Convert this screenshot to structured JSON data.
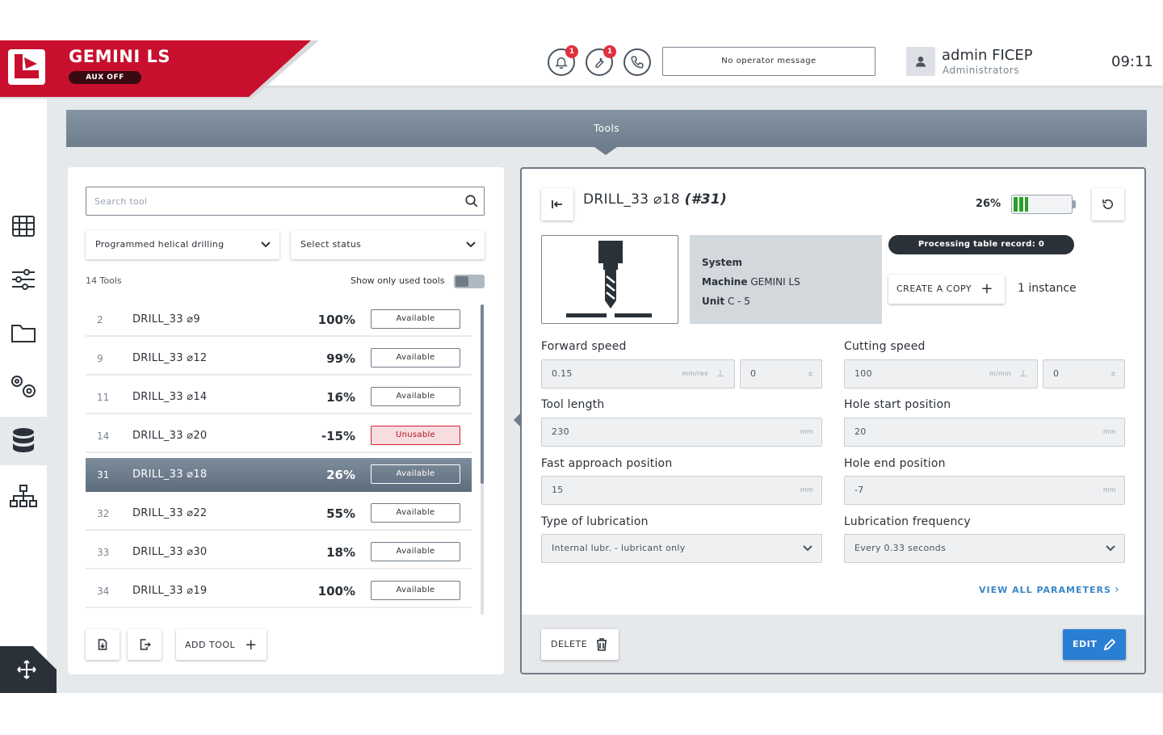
{
  "header": {
    "brand_title": "GEMINI LS",
    "aux_status": "AUX OFF",
    "notifications_badge": "1",
    "maintenance_badge": "1",
    "operator_message": "No operator message",
    "user_name": "admin FICEP",
    "user_role": "Administrators",
    "clock": "09:11",
    "brand_color": "#c8102e"
  },
  "sidebar": {
    "items": [
      {
        "name": "grid-icon"
      },
      {
        "name": "sliders-icon"
      },
      {
        "name": "folder-icon"
      },
      {
        "name": "gears-icon"
      },
      {
        "name": "database-icon",
        "active": true
      },
      {
        "name": "network-icon"
      }
    ]
  },
  "page": {
    "title": "Tools"
  },
  "tools_panel": {
    "search_placeholder": "Search tool",
    "filter_program": "Programmed helical drilling",
    "filter_status": "Select status",
    "tools_count": "14 Tools",
    "show_used_label": "Show only used tools",
    "show_used_enabled": false,
    "tools": [
      {
        "num": "2",
        "name": "DRILL_33 ⌀9",
        "pct": "100%",
        "status": "Available"
      },
      {
        "num": "9",
        "name": "DRILL_33 ⌀12",
        "pct": "99%",
        "status": "Available"
      },
      {
        "num": "11",
        "name": "DRILL_33 ⌀14",
        "pct": "16%",
        "status": "Available"
      },
      {
        "num": "14",
        "name": "DRILL_33 ⌀20",
        "pct": "-15%",
        "status": "Unusable"
      },
      {
        "num": "31",
        "name": "DRILL_33 ⌀18",
        "pct": "26%",
        "status": "Available",
        "selected": true
      },
      {
        "num": "32",
        "name": "DRILL_33 ⌀22",
        "pct": "55%",
        "status": "Available"
      },
      {
        "num": "33",
        "name": "DRILL_33 ⌀30",
        "pct": "18%",
        "status": "Available"
      },
      {
        "num": "34",
        "name": "DRILL_33 ⌀19",
        "pct": "100%",
        "status": "Available"
      }
    ],
    "add_tool_label": "ADD TOOL"
  },
  "detail": {
    "tool_name": "DRILL_33 ⌀18",
    "tool_id": "(#31)",
    "wear_pct": "26%",
    "wear_fraction": 0.26,
    "system_label": "System",
    "machine_label": "Machine",
    "machine_value": "GEMINI LS",
    "unit_label": "Unit",
    "unit_value": "C - 5",
    "processing_record": "Processing table record: 0",
    "create_copy_label": "CREATE A COPY",
    "instance_text": "1 instance",
    "forward_speed_label": "Forward speed",
    "forward_speed_value": "0.15",
    "forward_speed_unit": "mm/rev",
    "forward_speed_offset": "0",
    "cutting_speed_label": "Cutting speed",
    "cutting_speed_value": "100",
    "cutting_speed_unit": "m/min",
    "cutting_speed_offset": "0",
    "offset_unit": "±",
    "tool_length_label": "Tool length",
    "tool_length_value": "230",
    "hole_start_label": "Hole start position",
    "hole_start_value": "20",
    "fast_approach_label": "Fast approach position",
    "fast_approach_value": "15",
    "hole_end_label": "Hole end position",
    "hole_end_value": "-7",
    "mm_unit": "mm",
    "lubrication_type_label": "Type of lubrication",
    "lubrication_type_value": "Internal lubr. - lubricant only",
    "lubrication_freq_label": "Lubrication frequency",
    "lubrication_freq_value": "Every 0.33 seconds",
    "view_all_label": "VIEW ALL PARAMETERS",
    "delete_label": "DELETE",
    "edit_label": "EDIT",
    "edit_color": "#2a7fd4"
  }
}
